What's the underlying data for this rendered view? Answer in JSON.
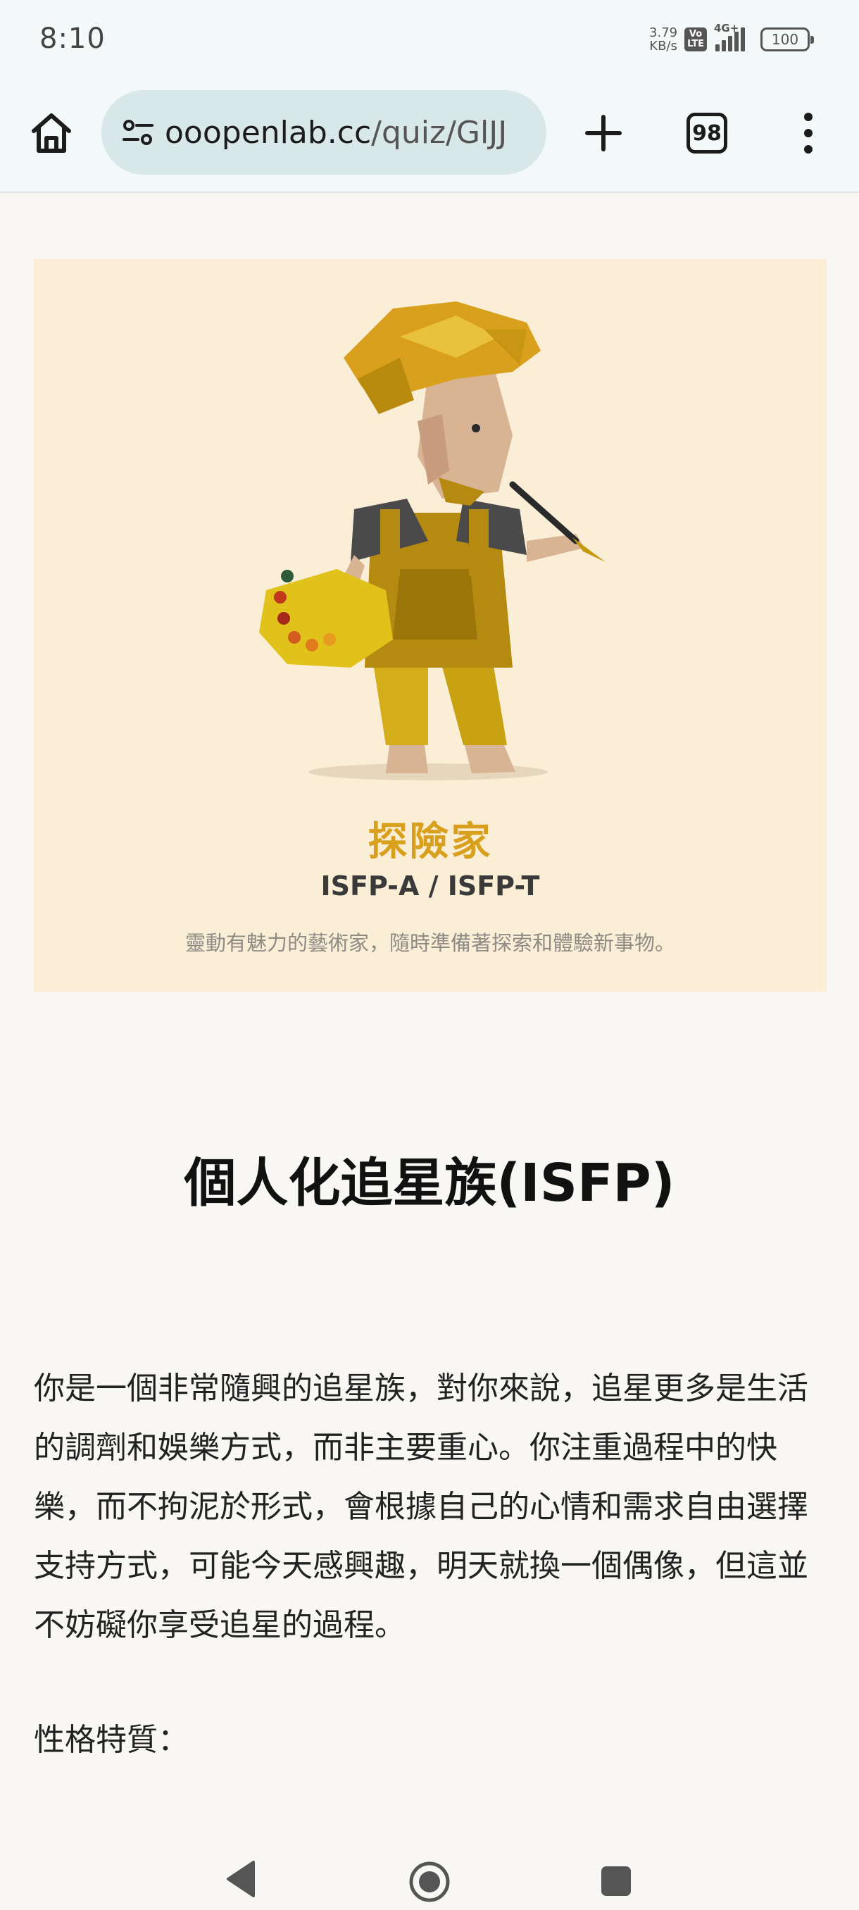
{
  "status_bar": {
    "time": "8:10",
    "net_speed_value": "3.79",
    "net_speed_unit": "KB/s",
    "volte_top": "Vo",
    "volte_bottom": "LTE",
    "network": "4G+",
    "battery": "100"
  },
  "browser": {
    "url_domain": "ooopenlab.cc",
    "url_path": "/quiz/GlJJ",
    "tab_count": "98"
  },
  "hero": {
    "type_name": "探險家",
    "type_code": "ISFP-A / ISFP-T",
    "type_desc": "靈動有魅力的藝術家，隨時準備著探索和體驗新事物。"
  },
  "result": {
    "title": "個人化追星族(ISFP)",
    "body": "你是一個非常隨興的追星族，對你來說，追星更多是生活的調劑和娛樂方式，而非主要重心。你注重過程中的快樂，而不拘泥於形式，會根據自己的心情和需求自由選擇支持方式，可能今天感興趣，明天就換一個偶像，但這並不妨礙你享受追星的過程。",
    "traits_label": "性格特質："
  },
  "colors": {
    "hero_bg": "#fbeed7",
    "accent_gold": "#d9a01e",
    "url_bar_bg": "#d8e7e8"
  }
}
